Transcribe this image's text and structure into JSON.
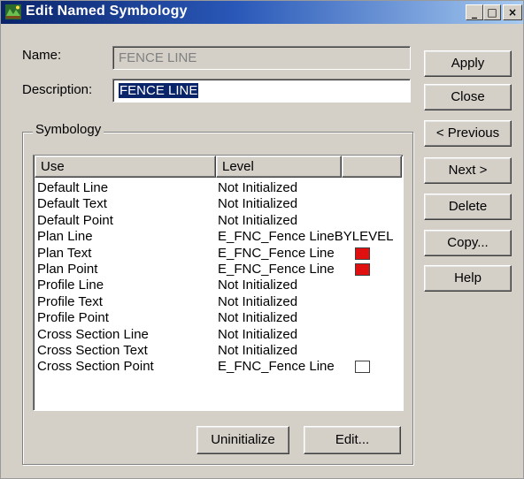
{
  "window": {
    "title": "Edit Named Symbology",
    "controls": {
      "minimize": "_",
      "maximize": "□",
      "close": "×"
    }
  },
  "form": {
    "name_label": "Name:",
    "name_value": "FENCE LINE",
    "description_label": "Description:",
    "description_value": "FENCE LINE"
  },
  "buttons": {
    "apply": "Apply",
    "close": "Close",
    "previous": "< Previous",
    "next": "Next >",
    "delete": "Delete",
    "copy": "Copy...",
    "help": "Help",
    "uninitialize": "Uninitialize",
    "edit": "Edit..."
  },
  "symbology": {
    "group_label": "Symbology",
    "columns": [
      "Use",
      "Level",
      ""
    ],
    "rows": [
      {
        "use": "Default Line",
        "level": "Not Initialized",
        "swatch": null
      },
      {
        "use": "Default Text",
        "level": "Not Initialized",
        "swatch": null
      },
      {
        "use": "Default Point",
        "level": "Not Initialized",
        "swatch": null
      },
      {
        "use": "Plan Line",
        "level": "E_FNC_Fence LineBYLEVEL",
        "swatch": null
      },
      {
        "use": "Plan Text",
        "level": "E_FNC_Fence Line",
        "swatch": "#e01010"
      },
      {
        "use": "Plan Point",
        "level": "E_FNC_Fence Line",
        "swatch": "#e01010"
      },
      {
        "use": "Profile Line",
        "level": "Not Initialized",
        "swatch": null
      },
      {
        "use": "Profile Text",
        "level": "Not Initialized",
        "swatch": null
      },
      {
        "use": "Profile Point",
        "level": "Not Initialized",
        "swatch": null
      },
      {
        "use": "Cross Section Line",
        "level": "Not Initialized",
        "swatch": null
      },
      {
        "use": "Cross Section Text",
        "level": "Not Initialized",
        "swatch": null
      },
      {
        "use": "Cross Section Point",
        "level": "E_FNC_Fence Line",
        "swatch": "#ffffff"
      }
    ]
  },
  "colors": {
    "title_bar": "#0a246a",
    "selection": "#0a246a",
    "face": "#d4d0c8",
    "swatch_red": "#e01010"
  }
}
